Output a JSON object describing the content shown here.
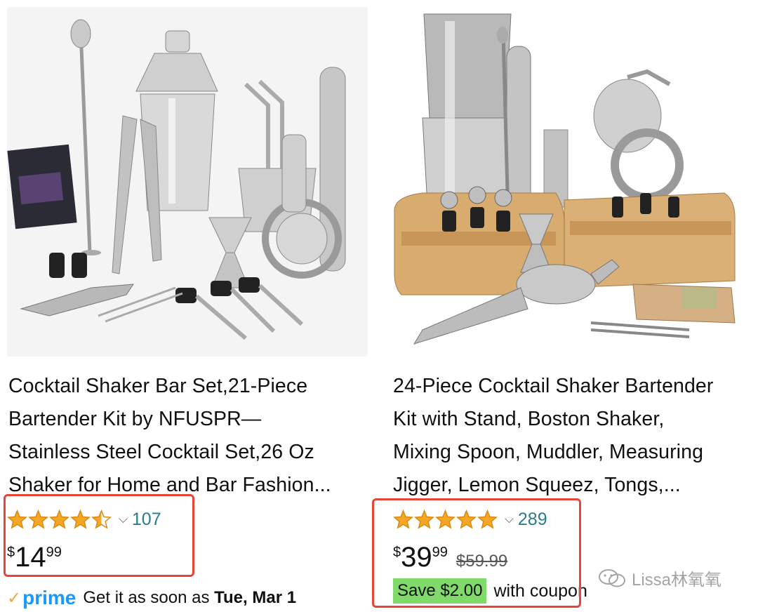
{
  "products": [
    {
      "title_lines": [
        "Cocktail Shaker Bar Set,21-Piece",
        "Bartender Kit by NFUSPR—",
        "Stainless Steel Cocktail Set,26 Oz",
        "Shaker for Home and Bar Fashion..."
      ],
      "rating": 4.5,
      "rating_count": "107",
      "price": {
        "currency": "$",
        "whole": "14",
        "fraction": "99"
      },
      "image": "bar-set-product-image",
      "delivery": {
        "badge": "prime",
        "text_prefix": "Get it as soon as ",
        "date": "Tue, Mar 1"
      }
    },
    {
      "title_lines": [
        "24-Piece Cocktail Shaker Bartender",
        "Kit with Stand, Boston Shaker,",
        "Mixing Spoon, Muddler, Measuring",
        "Jigger, Lemon Squeez, Tongs,..."
      ],
      "rating": 5,
      "rating_count": "289",
      "price": {
        "currency": "$",
        "whole": "39",
        "fraction": "99",
        "list_price": "$59.99"
      },
      "image": "bartender-kit-with-stand-image",
      "coupon": {
        "badge": "Save $2.00",
        "text": "with coupon"
      }
    }
  ],
  "ui": {
    "chevron": "⌵"
  },
  "watermark": {
    "text": "Lissa林氧氧",
    "icon": "wechat-icon"
  },
  "colors": {
    "star": "#f5a623",
    "rating_link": "#2a7c8f",
    "highlight": "#e8443a",
    "prime": "#1a98ff",
    "coupon": "#7fda69"
  }
}
